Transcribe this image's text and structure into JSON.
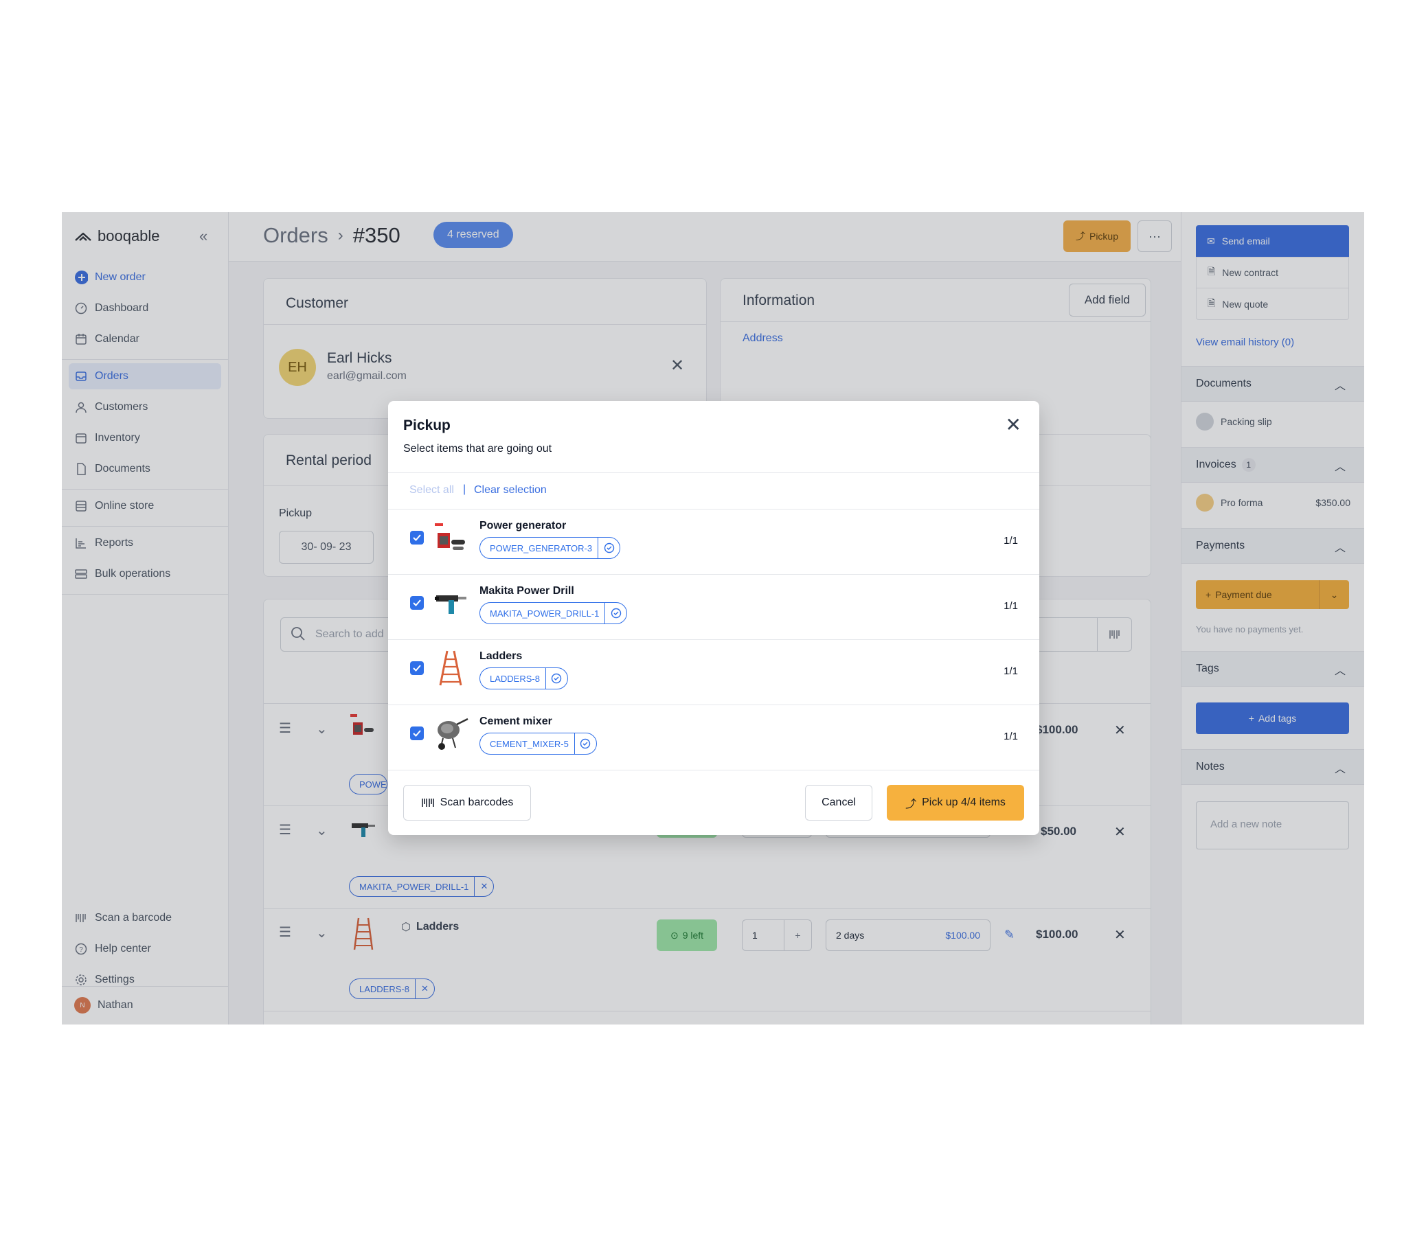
{
  "sidebar": {
    "brand": "booqable",
    "new_order": "New order",
    "items": [
      {
        "label": "Dashboard"
      },
      {
        "label": "Calendar"
      },
      {
        "label": "Orders"
      },
      {
        "label": "Customers"
      },
      {
        "label": "Inventory"
      },
      {
        "label": "Documents"
      },
      {
        "label": "Online store"
      },
      {
        "label": "Reports"
      },
      {
        "label": "Bulk operations"
      }
    ],
    "bottom": [
      {
        "label": "Scan a barcode"
      },
      {
        "label": "Help center"
      },
      {
        "label": "Settings"
      }
    ],
    "user": {
      "name": "Nathan",
      "initial": "N"
    }
  },
  "header": {
    "breadcrumb_root": "Orders",
    "order_number": "#350",
    "status_badge": "4 reserved",
    "pickup_button": "Pickup",
    "more_button": "···"
  },
  "customer": {
    "title": "Customer",
    "initials": "EH",
    "name": "Earl Hicks",
    "email": "earl@gmail.com"
  },
  "information": {
    "title": "Information",
    "add_field": "Add field",
    "address_link": "Address"
  },
  "rental_period": {
    "title": "Rental period",
    "pickup_label": "Pickup",
    "pickup_date": "30- 09- 23"
  },
  "lines": {
    "search_placeholder": "Search to add",
    "rows": [
      {
        "price": "$100.00",
        "tag": "POWE"
      },
      {
        "price": "$50.00",
        "tag": "MAKITA_POWER_DRILL-1"
      },
      {
        "name": "Ladders",
        "stock": "9 left",
        "qty": "1",
        "period": "2 days",
        "period_price": "$100.00",
        "price": "$100.00",
        "tag": "LADDERS-8"
      }
    ]
  },
  "right_panel": {
    "send_email": "Send email",
    "new_contract": "New contract",
    "new_quote": "New quote",
    "email_history": "View email history (0)",
    "documents": {
      "title": "Documents",
      "item": "Packing slip"
    },
    "invoices": {
      "title": "Invoices",
      "count": "1",
      "item": "Pro forma",
      "amount": "$350.00"
    },
    "payments": {
      "title": "Payments",
      "button": "Payment due",
      "empty": "You have no payments yet."
    },
    "tags": {
      "title": "Tags",
      "button": "Add tags"
    },
    "notes": {
      "title": "Notes",
      "placeholder": "Add a new note"
    }
  },
  "modal": {
    "title": "Pickup",
    "subtitle": "Select items that are going out",
    "select_all": "Select all",
    "separator": "|",
    "clear_selection": "Clear selection",
    "items": [
      {
        "name": "Power generator",
        "tag": "POWER_GENERATOR-3",
        "count": "1/1",
        "checked": true
      },
      {
        "name": "Makita Power Drill",
        "tag": "MAKITA_POWER_DRILL-1",
        "count": "1/1",
        "checked": true
      },
      {
        "name": "Ladders",
        "tag": "LADDERS-8",
        "count": "1/1",
        "checked": true
      },
      {
        "name": "Cement mixer",
        "tag": "CEMENT_MIXER-5",
        "count": "1/1",
        "checked": true
      }
    ],
    "scan_barcodes": "Scan barcodes",
    "cancel": "Cancel",
    "pick_up": "Pick up 4/4 items"
  },
  "colors": {
    "accent": "#2f6fe8",
    "pickup_orange": "#f6b13e",
    "stock_green": "#9ee6a8"
  }
}
